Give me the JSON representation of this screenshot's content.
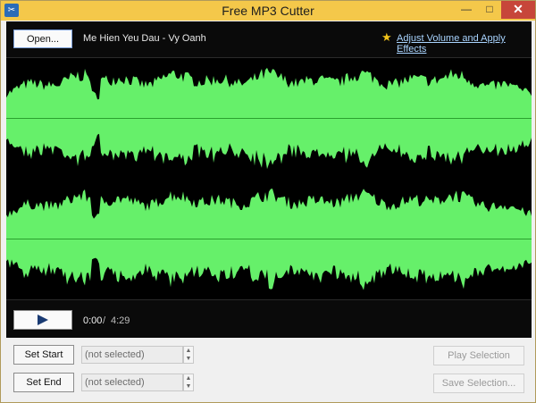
{
  "window": {
    "title": "Free MP3 Cutter",
    "icon": "scissors-icon",
    "controls": {
      "minimize": "—",
      "maximize": "□",
      "close": "✕"
    }
  },
  "toolbar": {
    "open_label": "Open...",
    "file_title": "Me Hien Yeu Dau - Vy Oanh",
    "effects_icon": "star-icon",
    "effects_link": "Adjust Volume and Apply Effects"
  },
  "waveform": {
    "channels": 2,
    "wave_color": "#66f06a",
    "background_color": "#000000"
  },
  "transport": {
    "current_time": "0:00",
    "separator": "/",
    "total_time": "4:29",
    "play_icon": "play-icon"
  },
  "selection": {
    "set_start_label": "Set Start",
    "set_end_label": "Set End",
    "start_value": "(not selected)",
    "end_value": "(not selected)",
    "play_selection_label": "Play Selection",
    "save_selection_label": "Save Selection..."
  },
  "colors": {
    "titlebar": "#f4c84a",
    "close_button": "#c7463a",
    "link": "#a9d4ff",
    "panel": "#0a0a0a"
  }
}
